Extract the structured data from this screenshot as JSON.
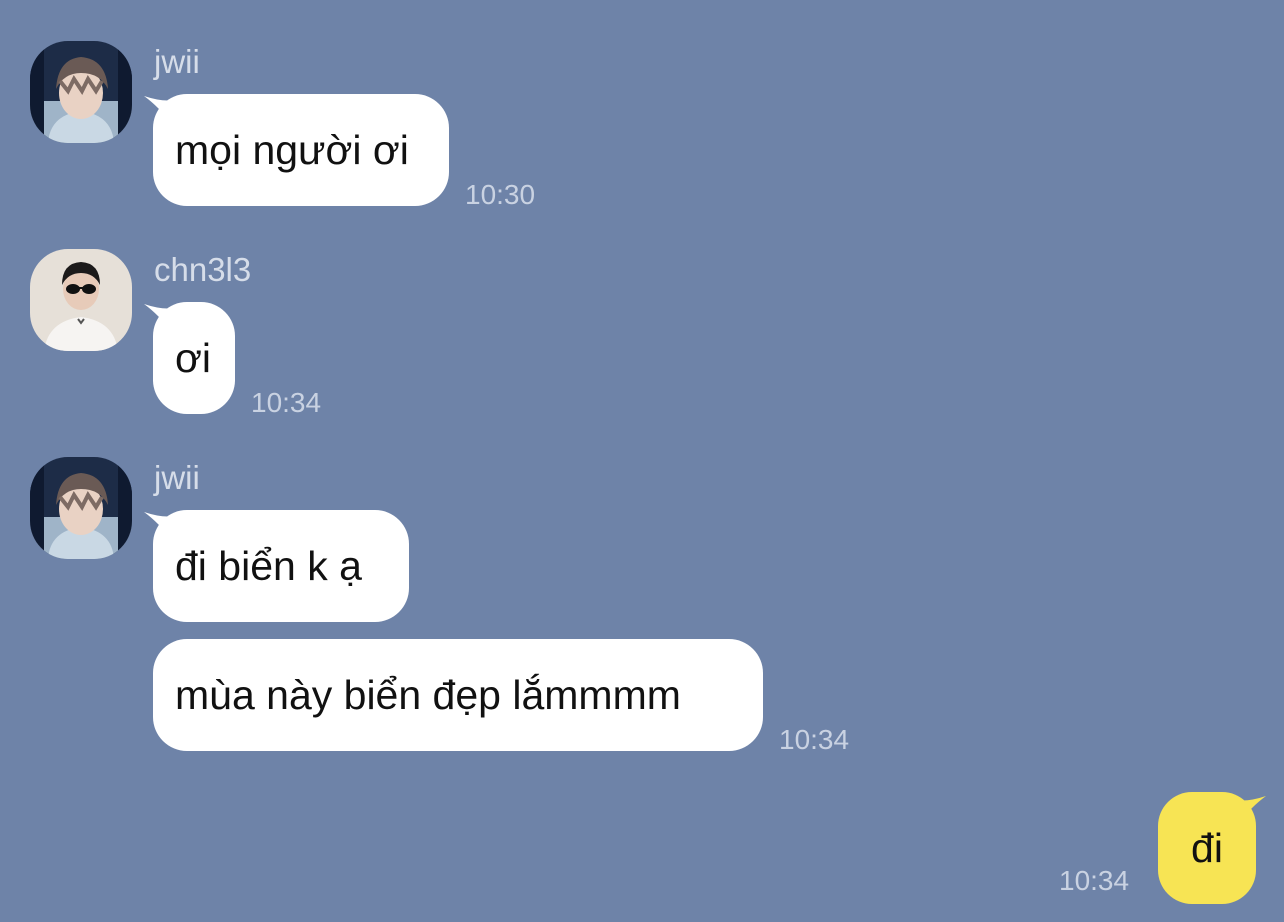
{
  "colors": {
    "background": "#6e83a8",
    "incoming_bubble": "#ffffff",
    "outgoing_bubble": "#f7e454",
    "meta_text": "#d6dde9"
  },
  "messages": [
    {
      "sender": "jwii",
      "avatar": "avatar-jwii",
      "bubbles": [
        "mọi người ơi"
      ],
      "time": "10:30"
    },
    {
      "sender": "chn3l3",
      "avatar": "avatar-chn3l3",
      "bubbles": [
        "ơi"
      ],
      "time": "10:34"
    },
    {
      "sender": "jwii",
      "avatar": "avatar-jwii",
      "bubbles": [
        "đi biển k ạ",
        "mùa này biển đẹp lắmmmm"
      ],
      "time": "10:34"
    }
  ],
  "outgoing": {
    "text": "đi",
    "time": "10:34"
  }
}
